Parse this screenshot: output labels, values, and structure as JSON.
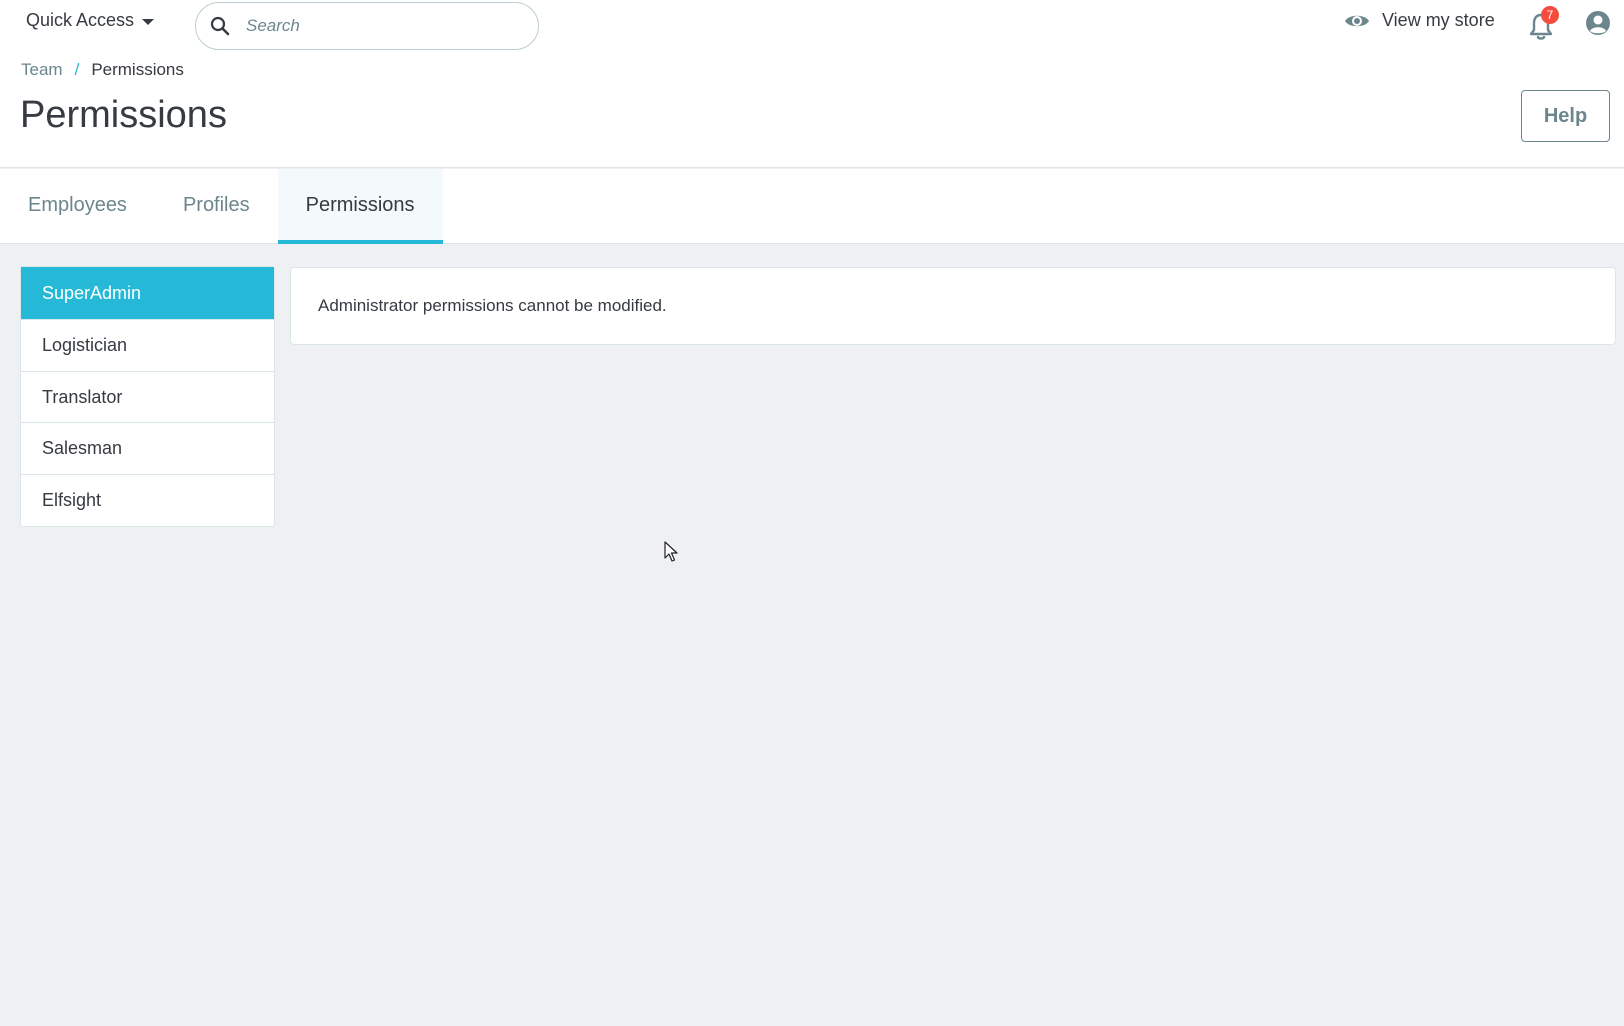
{
  "header": {
    "quick_access_label": "Quick Access",
    "search_placeholder": "Search",
    "view_store_label": "View my store",
    "notification_count": "7"
  },
  "breadcrumb": {
    "parent": "Team",
    "separator": "/",
    "current": "Permissions"
  },
  "page": {
    "title": "Permissions",
    "help_label": "Help"
  },
  "tabs": [
    {
      "label": "Employees",
      "active": false
    },
    {
      "label": "Profiles",
      "active": false
    },
    {
      "label": "Permissions",
      "active": true
    }
  ],
  "profiles": [
    {
      "label": "SuperAdmin",
      "active": true
    },
    {
      "label": "Logistician",
      "active": false
    },
    {
      "label": "Translator",
      "active": false
    },
    {
      "label": "Salesman",
      "active": false
    },
    {
      "label": "Elfsight",
      "active": false
    }
  ],
  "message": {
    "text": "Administrator permissions cannot be modified."
  },
  "colors": {
    "accent": "#25b9d7",
    "badge": "#f54c3e",
    "background": "#eef0f4",
    "text": "#363a41",
    "muted": "#6c868e"
  },
  "icons": {
    "search": "search-icon",
    "eye": "eye-icon",
    "bell": "bell-icon",
    "profile": "user-circle-icon",
    "caret": "caret-down-icon"
  }
}
